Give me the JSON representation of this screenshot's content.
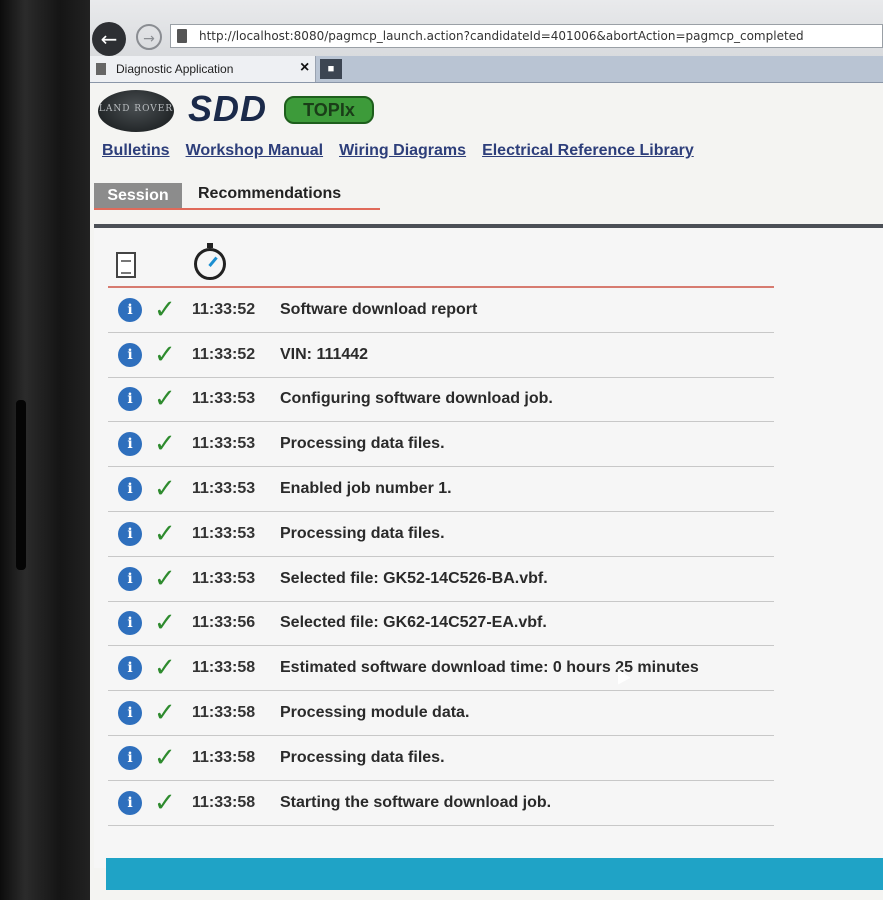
{
  "browser": {
    "url": "http://localhost:8080/pagmcp_launch.action?candidateId=401006&abortAction=pagmcp_completed",
    "tab_title": "Diagnostic Application",
    "tab_close": "×"
  },
  "app": {
    "logo_text": "LAND ROVER",
    "brand": "SDD",
    "topix_badge": "TOPIx",
    "top_links": [
      "Bulletins",
      "Workshop Manual",
      "Wiring Diagrams",
      "Electrical Reference Library"
    ],
    "tabs": [
      "Session",
      "Recommendations"
    ]
  },
  "log": [
    {
      "time": "11:33:52",
      "message": "Software download report"
    },
    {
      "time": "11:33:52",
      "message": "VIN: 111442"
    },
    {
      "time": "11:33:53",
      "message": "Configuring software download job."
    },
    {
      "time": "11:33:53",
      "message": "Processing data files."
    },
    {
      "time": "11:33:53",
      "message": "Enabled job number 1."
    },
    {
      "time": "11:33:53",
      "message": "Processing data files."
    },
    {
      "time": "11:33:53",
      "message": "Selected file: GK52-14C526-BA.vbf."
    },
    {
      "time": "11:33:56",
      "message": "Selected file: GK62-14C527-EA.vbf."
    },
    {
      "time": "11:33:58",
      "message": "Estimated software download time: 0 hours 25 minutes"
    },
    {
      "time": "11:33:58",
      "message": "Processing module data."
    },
    {
      "time": "11:33:58",
      "message": "Processing data files."
    },
    {
      "time": "11:33:58",
      "message": "Starting the software download job."
    }
  ],
  "colors": {
    "info_icon": "#2e6fbd",
    "check": "#2e8b2e",
    "footer": "#1fa3c6"
  }
}
